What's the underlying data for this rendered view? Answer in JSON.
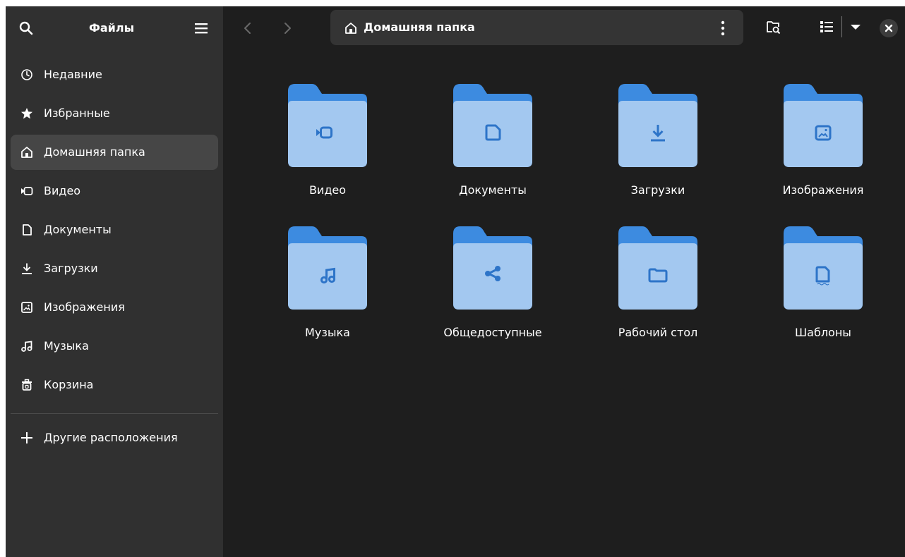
{
  "sidebar": {
    "title": "Файлы",
    "items": [
      {
        "label": "Недавние",
        "icon": "clock-icon"
      },
      {
        "label": "Избранные",
        "icon": "star-icon"
      },
      {
        "label": "Домашняя папка",
        "icon": "home-icon",
        "active": true
      },
      {
        "label": "Видео",
        "icon": "video-icon"
      },
      {
        "label": "Документы",
        "icon": "document-icon"
      },
      {
        "label": "Загрузки",
        "icon": "download-icon"
      },
      {
        "label": "Изображения",
        "icon": "image-icon"
      },
      {
        "label": "Музыка",
        "icon": "music-icon"
      },
      {
        "label": "Корзина",
        "icon": "trash-icon"
      }
    ],
    "other_locations": "Другие расположения"
  },
  "header": {
    "path_label": "Домашняя папка"
  },
  "folders": [
    {
      "name": "Видео",
      "icon": "video-icon"
    },
    {
      "name": "Документы",
      "icon": "document-icon"
    },
    {
      "name": "Загрузки",
      "icon": "download-icon"
    },
    {
      "name": "Изображения",
      "icon": "image-icon"
    },
    {
      "name": "Музыка",
      "icon": "music-icon"
    },
    {
      "name": "Общедоступные",
      "icon": "share-icon"
    },
    {
      "name": "Рабочий стол",
      "icon": "desktop-folder-icon"
    },
    {
      "name": "Шаблоны",
      "icon": "template-icon"
    }
  ],
  "colors": {
    "window_bg": "#1e1e1e",
    "sidebar_bg": "#303030",
    "sidebar_active": "#464646",
    "folder_front": "#a3c8f0",
    "folder_back": "#3d8be0",
    "folder_glyph": "#2d74c8"
  }
}
